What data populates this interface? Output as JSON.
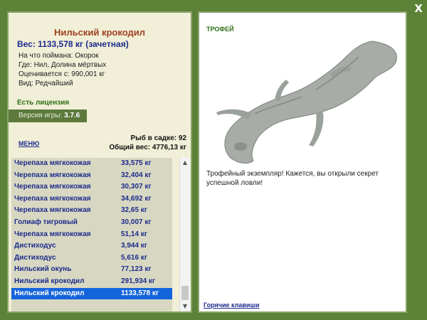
{
  "window": {
    "close_glyph": "X"
  },
  "fish": {
    "title": "Нильский крокодил",
    "weight": "Вес: 1133,578 кг (зачетная)",
    "bait": "На что поймана: Окорок",
    "location": "Где: Нил, Долина мёртвых",
    "value": "Оценивается с: 990,001 кг",
    "kind": "Вид: Редчайший"
  },
  "license": "Есть лицензия",
  "version": {
    "label": "Версия игры:",
    "number": "3.7.6"
  },
  "menu_label": "МЕНЮ",
  "keepnet": {
    "count_label": "Рыб в садке: 92",
    "total_label": "Общий вес: 4776,13 кг"
  },
  "catch_list": [
    {
      "name": "Черепаха мягкокожая",
      "weight": "33,575 кг"
    },
    {
      "name": "Черепаха мягкокожая",
      "weight": "32,404 кг"
    },
    {
      "name": "Черепаха мягкокожая",
      "weight": "30,307 кг"
    },
    {
      "name": "Черепаха мягкокожая",
      "weight": "34,692 кг"
    },
    {
      "name": "Черепаха мягкокожая",
      "weight": "32,65 кг"
    },
    {
      "name": "Голиаф тигровый",
      "weight": "30,007 кг"
    },
    {
      "name": "Черепаха мягкокожая",
      "weight": "51,14 кг"
    },
    {
      "name": "Дистиходус",
      "weight": "3,944 кг"
    },
    {
      "name": "Дистиходус",
      "weight": "5,616 кг"
    },
    {
      "name": "Нильский окунь",
      "weight": "77,123 кг"
    },
    {
      "name": "Нильский крокодил",
      "weight": "291,934 кг"
    },
    {
      "name": "Нильский крокодил",
      "weight": "1133,578 кг",
      "selected": true
    }
  ],
  "trophy": {
    "label": "ТРОФЕЙ",
    "text": "Трофейный экземпляр! Кажется, вы открыли секрет успешной ловли!",
    "hotkeys": "Горячие клавиши"
  },
  "colors": {
    "background": "#5b8237",
    "selection": "#1464dc",
    "title": "#a0411f",
    "link": "#1c2a8c"
  }
}
